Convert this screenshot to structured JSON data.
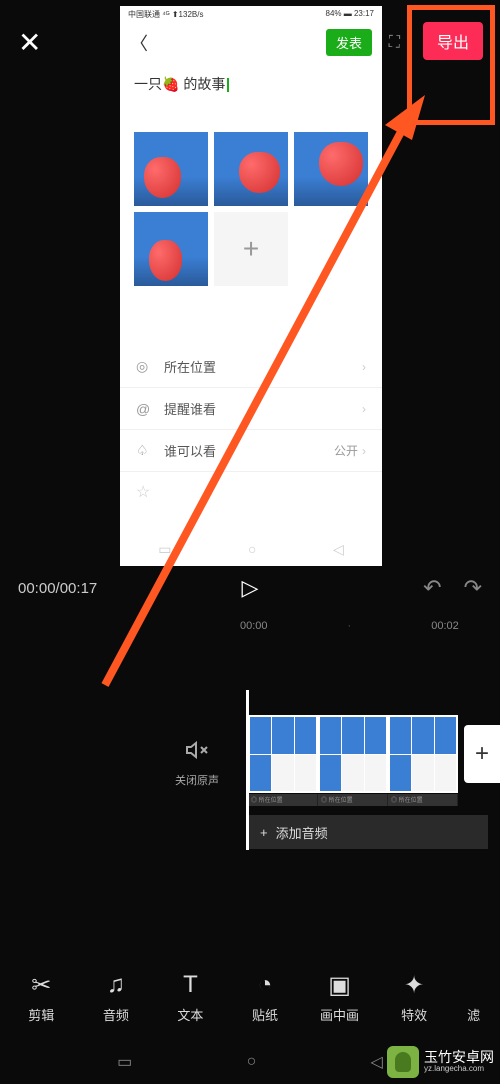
{
  "export_label": "导出",
  "phone": {
    "status_left": "中国联通 ⁴ᴳ ⬆132B/s",
    "status_right": "84% ▬ 23:17",
    "publish_label": "发表",
    "post_title": "一只🍓 的故事",
    "options": [
      {
        "icon": "◎",
        "label": "所在位置",
        "value": ""
      },
      {
        "icon": "@",
        "label": "提醒谁看",
        "value": ""
      },
      {
        "icon": "♤",
        "label": "谁可以看",
        "value": "公开"
      }
    ]
  },
  "playback": {
    "current": "00:00",
    "total": "00:17",
    "ruler": [
      "00:00",
      "·",
      "00:02",
      "·"
    ]
  },
  "mute_label": "关闭原声",
  "audio_track_label": "添加音频",
  "toolbar": [
    {
      "icon": "✂",
      "label": "剪辑"
    },
    {
      "icon": "♫",
      "label": "音频"
    },
    {
      "icon": "T",
      "label": "文本"
    },
    {
      "icon": "◔",
      "label": "贴纸"
    },
    {
      "icon": "▣",
      "label": "画中画"
    },
    {
      "icon": "✦",
      "label": "特效"
    },
    {
      "icon": "",
      "label": "滤"
    }
  ],
  "watermark": {
    "name": "玉竹安卓网",
    "url": "yz.langecha.com"
  }
}
